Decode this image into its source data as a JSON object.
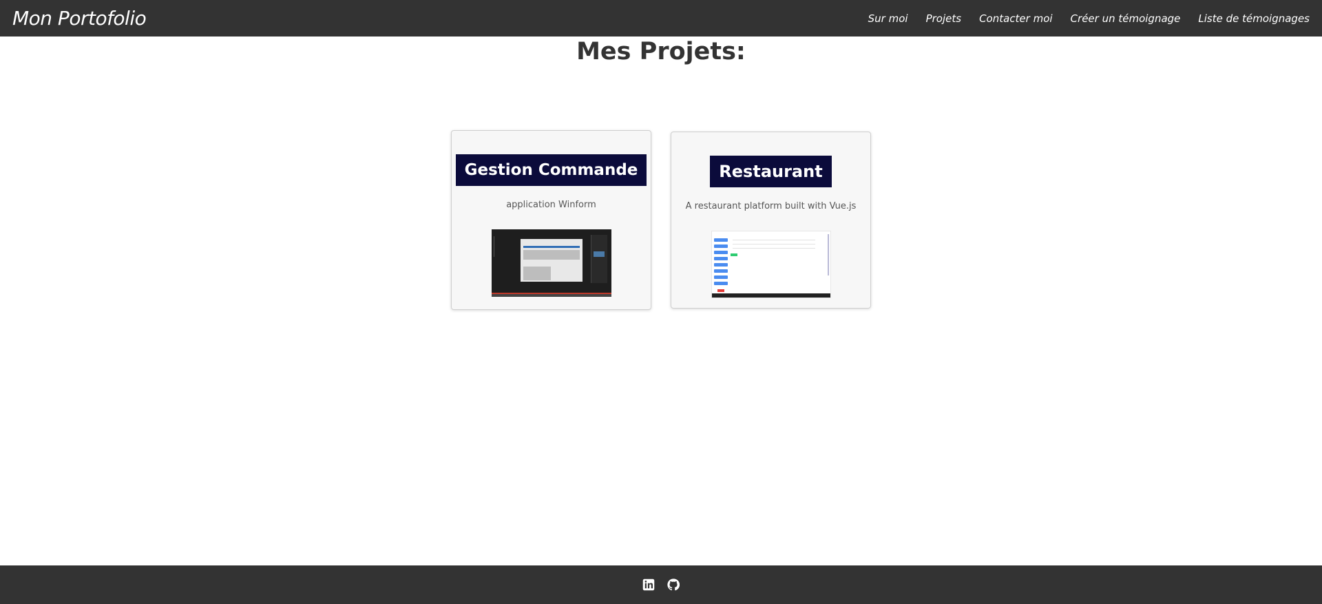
{
  "navbar": {
    "brand": "Mon Portofolio",
    "links": [
      "Sur moi",
      "Projets",
      "Contacter moi",
      "Créer un témoignage",
      "Liste de témoignages"
    ]
  },
  "main": {
    "title": "Mes Projets:",
    "projects": [
      {
        "title": "Gestion Commande",
        "description": "application Winform",
        "thumbnail": "ide-screenshot"
      },
      {
        "title": "Restaurant",
        "description": "A restaurant platform built with Vue.js",
        "thumbnail": "web-app-screenshot"
      }
    ]
  },
  "footer": {
    "icons": [
      "linkedin-icon",
      "github-icon"
    ]
  },
  "colors": {
    "navbar_bg": "#333333",
    "card_title_bg": "#0b0b3b",
    "card_bg": "#f7f7f7"
  }
}
